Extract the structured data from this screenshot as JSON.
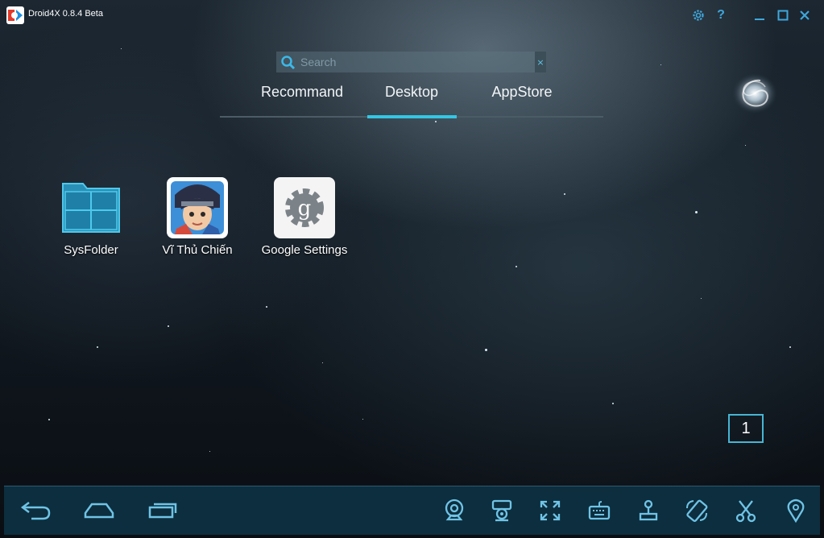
{
  "window": {
    "title": "Droid4X 0.8.4 Beta"
  },
  "titlebar_buttons": [
    "gear-icon",
    "help-icon",
    "minimize-icon",
    "maximize-icon",
    "close-icon"
  ],
  "search": {
    "placeholder": "Search",
    "clear_label": "×"
  },
  "tabs": [
    {
      "label": "Recommand",
      "active": false
    },
    {
      "label": "Desktop",
      "active": true
    },
    {
      "label": "AppStore",
      "active": false
    }
  ],
  "apps": [
    {
      "label": "SysFolder",
      "icon": "folder-icon"
    },
    {
      "label": "Vĩ Thủ Chiến",
      "icon": "game-icon"
    },
    {
      "label": "Google Settings",
      "icon": "google-settings-icon"
    }
  ],
  "page_indicator": "1",
  "bottom_bar": {
    "left": [
      "back-icon",
      "home-icon",
      "recent-apps-icon"
    ],
    "right": [
      "camera-icon",
      "screen-record-icon",
      "fullscreen-icon",
      "keyboard-icon",
      "joystick-icon",
      "rotate-icon",
      "screenshot-icon",
      "location-icon"
    ]
  },
  "colors": {
    "accent": "#33c6e4",
    "bottom_bar": "#0e3042",
    "icon": "#6fc3e6"
  }
}
